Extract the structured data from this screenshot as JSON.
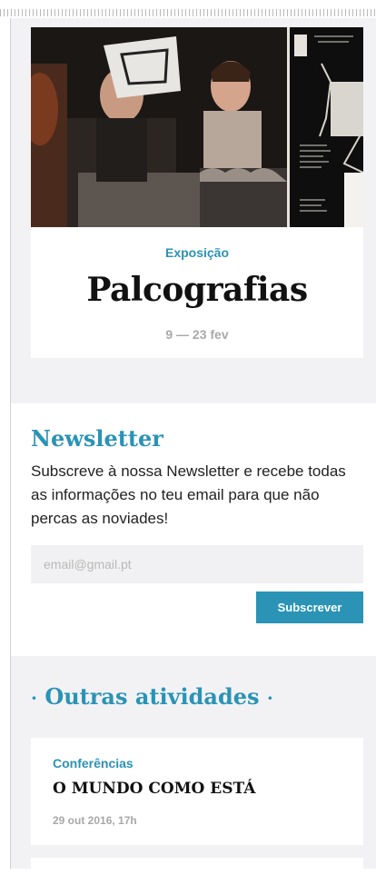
{
  "event": {
    "category": "Exposição",
    "title": "Palcografias",
    "dates": "9 — 23 fev"
  },
  "newsletter": {
    "title": "Newsletter",
    "description": "Subscreve à nossa Newsletter e recebe todas as informações no teu email para que não percas as noviades!",
    "email_placeholder": "email@gmail.pt",
    "button_label": "Subscrever"
  },
  "other_activities": {
    "title_prefix": "·",
    "title": "Outras atividades",
    "title_suffix": "·",
    "items": [
      {
        "category": "Conferências",
        "title": "O MUNDO COMO ESTÁ",
        "date": "29 out 2016, 17h"
      }
    ]
  },
  "colors": {
    "accent": "#2a93b6",
    "section_bg": "#f2f2f4",
    "muted_text": "#a8a8a8"
  }
}
